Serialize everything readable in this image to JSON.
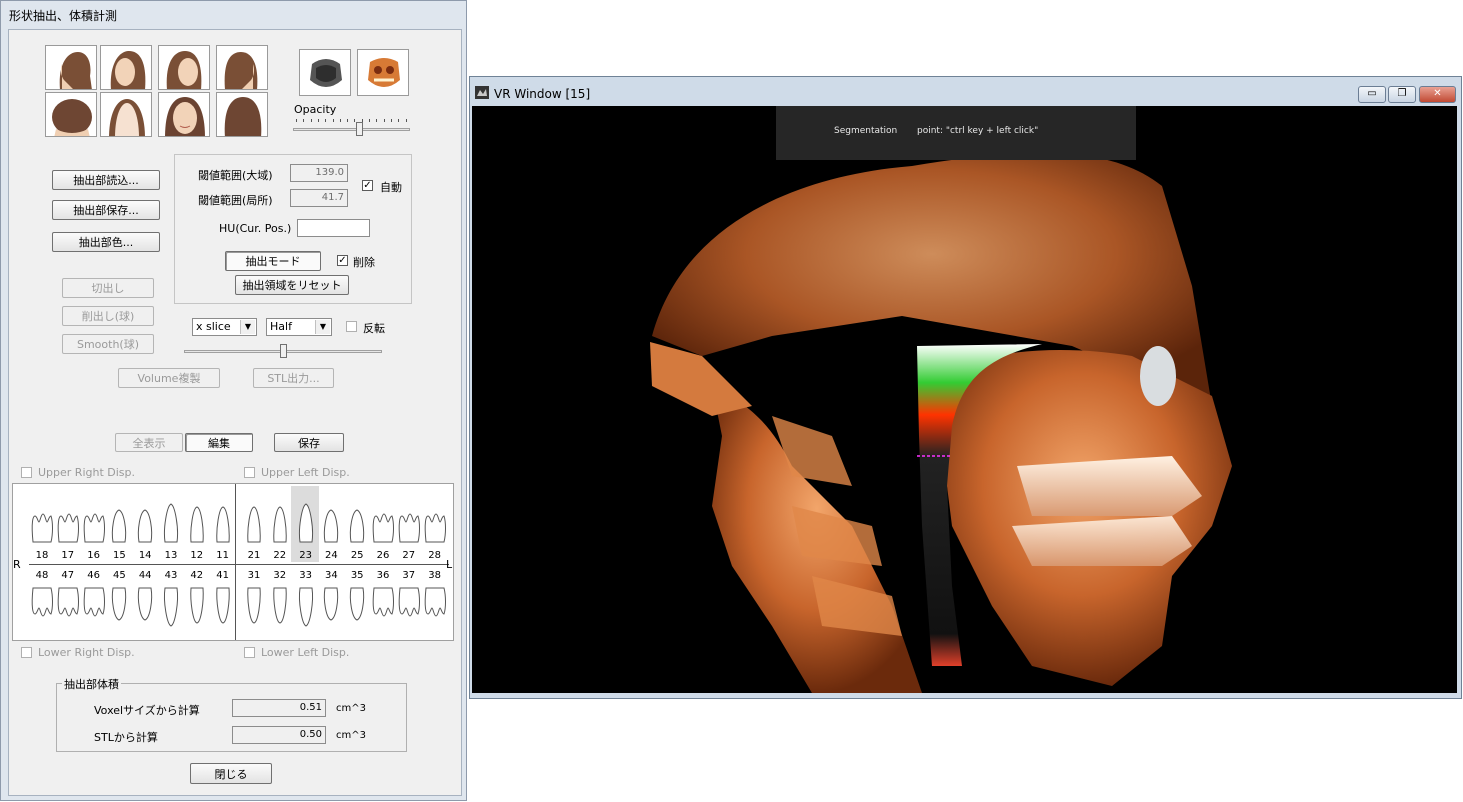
{
  "dialog": {
    "title": "形状抽出、体積計測",
    "opacity_label": "Opacity",
    "opacity_value": 0.6,
    "buttons": {
      "load": "抽出部読込...",
      "save_part": "抽出部保存...",
      "color": "抽出部色...",
      "cut": "切出し",
      "carve_sphere": "削出し(球)",
      "smooth_sphere": "Smooth(球)",
      "volume_copy": "Volume複製",
      "stl_export": "STL出力...",
      "extract_mode": "抽出モード",
      "reset_region": "抽出領域をリセット",
      "show_all": "全表示",
      "edit": "編集",
      "save": "保存",
      "close": "閉じる"
    },
    "threshold": {
      "global_label": "閾値範囲(大域)",
      "global_value": "139.0",
      "local_label": "閾値範囲(局所)",
      "local_value": "41.7",
      "auto_label": "自動",
      "auto_checked": true,
      "hu_label": "HU(Cur. Pos.)",
      "hu_value": "",
      "delete_label": "削除",
      "delete_checked": true
    },
    "slice": {
      "axis_selected": "x slice",
      "mode_selected": "Half",
      "invert_label": "反転",
      "invert_checked": false,
      "slider_value": 0.5
    },
    "teeth": {
      "upper_right_disp": "Upper Right Disp.",
      "upper_left_disp": "Upper Left Disp.",
      "lower_right_disp": "Lower Right Disp.",
      "lower_left_disp": "Lower Left Disp.",
      "right_marker": "R",
      "left_marker": "L",
      "upper_numbers": [
        "18",
        "17",
        "16",
        "15",
        "14",
        "13",
        "12",
        "11",
        "21",
        "22",
        "23",
        "24",
        "25",
        "26",
        "27",
        "28"
      ],
      "lower_numbers": [
        "48",
        "47",
        "46",
        "45",
        "44",
        "43",
        "42",
        "41",
        "31",
        "32",
        "33",
        "34",
        "35",
        "36",
        "37",
        "38"
      ],
      "selected_tooth": "23"
    },
    "volume": {
      "group_label": "抽出部体積",
      "voxel_label": "Voxelサイズから計算",
      "voxel_value": "0.51",
      "stl_label": "STLから計算",
      "stl_value": "0.50",
      "unit": "cm^3"
    }
  },
  "vr_window": {
    "title": "VR Window [15]",
    "banner_mode": "Segmentation",
    "banner_hint": "point: \"ctrl key + left click\"",
    "controls": {
      "minimize": "▭",
      "restore": "❐",
      "close": "✕"
    }
  }
}
